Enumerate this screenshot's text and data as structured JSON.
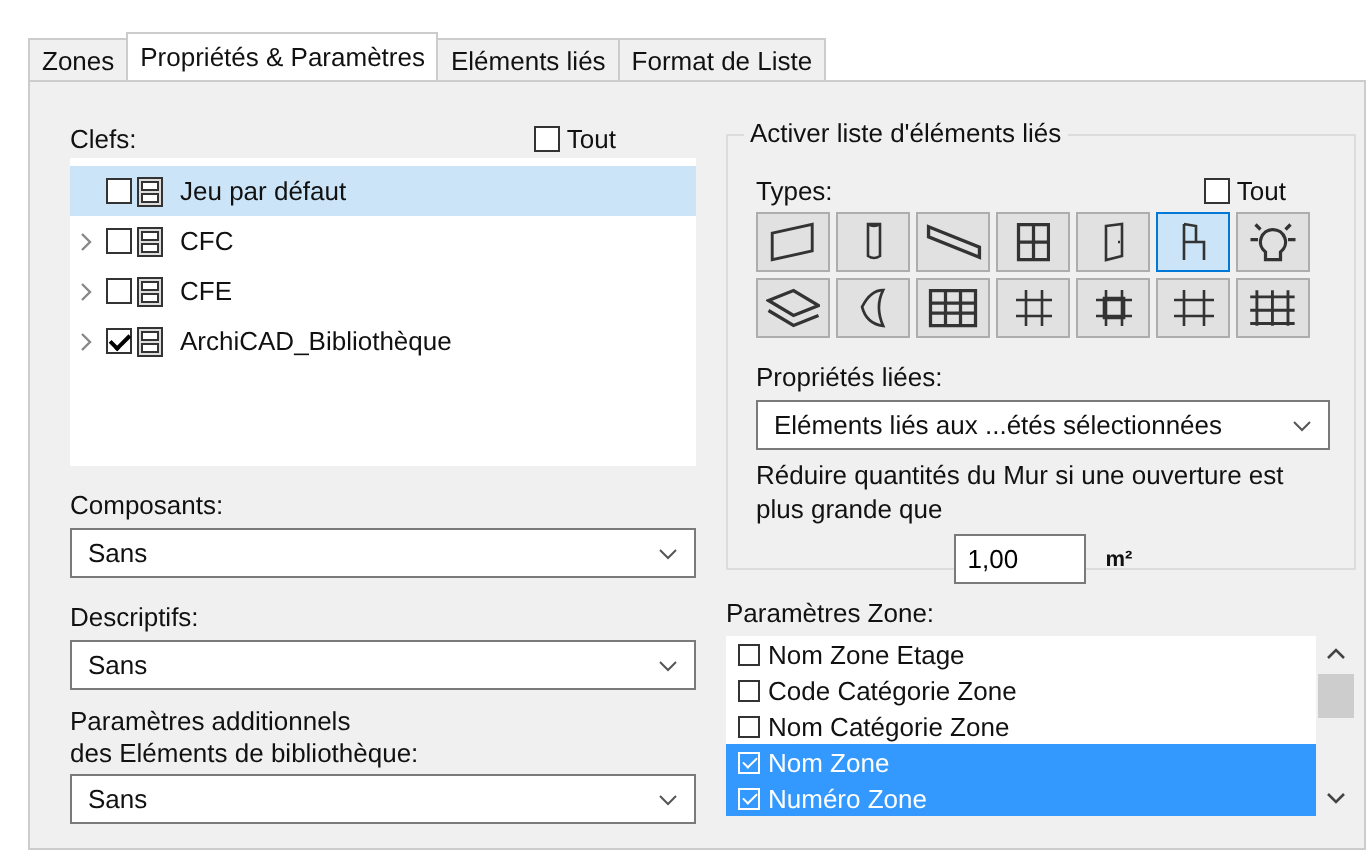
{
  "tabs": [
    {
      "label": "Zones",
      "selected": false
    },
    {
      "label": "Propriétés & Paramètres",
      "selected": true
    },
    {
      "label": "Eléments liés",
      "selected": false
    },
    {
      "label": "Format de Liste",
      "selected": false
    }
  ],
  "keys": {
    "label": "Clefs:",
    "all": {
      "label": "Tout",
      "checked": false
    },
    "items": [
      {
        "label": "Jeu par défaut",
        "checked": false,
        "selected": true,
        "expandable": false
      },
      {
        "label": "CFC",
        "checked": false,
        "selected": false,
        "expandable": true
      },
      {
        "label": "CFE",
        "checked": false,
        "selected": false,
        "expandable": true
      },
      {
        "label": "ArchiCAD_Bibliothèque",
        "checked": true,
        "selected": false,
        "expandable": true
      }
    ]
  },
  "components": {
    "label": "Composants:",
    "value": "Sans"
  },
  "descriptions": {
    "label": "Descriptifs:",
    "value": "Sans"
  },
  "additional": {
    "label": "Paramètres additionnels\ndes Eléments de bibliothèque:",
    "value": "Sans"
  },
  "linked": {
    "title": "Activer liste d'éléments liés",
    "types_label": "Types:",
    "all": {
      "label": "Tout",
      "checked": false
    },
    "types": [
      {
        "selected": false
      },
      {
        "selected": false
      },
      {
        "selected": false
      },
      {
        "selected": false
      },
      {
        "selected": false
      },
      {
        "selected": true
      },
      {
        "selected": false
      },
      {
        "selected": false
      },
      {
        "selected": false
      },
      {
        "selected": false
      },
      {
        "selected": false
      },
      {
        "selected": false
      },
      {
        "selected": false
      },
      {
        "selected": false
      }
    ],
    "properties_label": "Propriétés liées:",
    "properties_value": "Eléments liés aux ...étés sélectionnées",
    "reduce_text": "Réduire quantités du Mur si une ouverture est plus grande que",
    "reduce_value": "1,00",
    "unit": "m²"
  },
  "zone_params": {
    "label": "Paramètres Zone:",
    "items": [
      {
        "label": "Nom Zone Etage",
        "checked": false,
        "selected": false
      },
      {
        "label": "Code Catégorie Zone",
        "checked": false,
        "selected": false
      },
      {
        "label": "Nom Catégorie Zone",
        "checked": false,
        "selected": false
      },
      {
        "label": "Nom Zone",
        "checked": true,
        "selected": true
      },
      {
        "label": "Numéro Zone",
        "checked": true,
        "selected": true
      }
    ]
  }
}
